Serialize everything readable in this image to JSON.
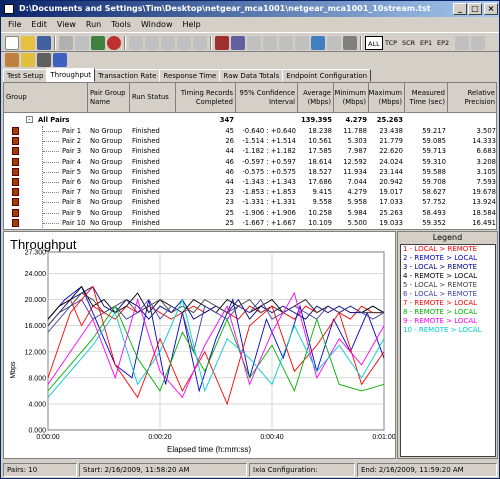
{
  "window": {
    "title": "D:\\Documents and Settings\\Tim\\Desktop\\netgear_mca1001\\netgear_mca1001_10stream.tst"
  },
  "menu": [
    "File",
    "Edit",
    "View",
    "Run",
    "Tools",
    "Window",
    "Help"
  ],
  "toolbar2": {
    "labels": [
      "ALL",
      "TCP",
      "SCR",
      "EP1",
      "EP2"
    ]
  },
  "tabs": [
    "Test Setup",
    "Throughput",
    "Transaction Rate",
    "Response Time",
    "Raw Data Totals",
    "Endpoint Configuration"
  ],
  "table": {
    "headers": [
      "Group",
      "Pair Group\nName",
      "Run Status",
      "Timing Records\nCompleted",
      "95% Confidence\nInterval",
      "Average\n(Mbps)",
      "Minimum\n(Mbps)",
      "Maximum\n(Mbps)",
      "Measured\nTime (sec)",
      "Relative\nPrecision"
    ],
    "all": {
      "label": "All Pairs",
      "records": "347",
      "average": "139.395",
      "minimum": "4.279",
      "maximum": "25.263"
    },
    "rows": [
      {
        "pair": "Pair 1",
        "group": "No Group",
        "status": "Finished",
        "records": "45",
        "ci": "-0.640 : +0.640",
        "avg": "18.238",
        "min": "11.788",
        "max": "23.438",
        "time": "59.217",
        "prec": "3.507"
      },
      {
        "pair": "Pair 2",
        "group": "No Group",
        "status": "Finished",
        "records": "26",
        "ci": "-1.514 : +1.514",
        "avg": "10.561",
        "min": "5.303",
        "max": "21.779",
        "time": "59.085",
        "prec": "14.333"
      },
      {
        "pair": "Pair 3",
        "group": "No Group",
        "status": "Finished",
        "records": "44",
        "ci": "-1.182 : +1.182",
        "avg": "17.585",
        "min": "7.987",
        "max": "22.620",
        "time": "59.713",
        "prec": "6.683"
      },
      {
        "pair": "Pair 4",
        "group": "No Group",
        "status": "Finished",
        "records": "46",
        "ci": "-0.597 : +0.597",
        "avg": "18.614",
        "min": "12.592",
        "max": "24.024",
        "time": "59.310",
        "prec": "3.208"
      },
      {
        "pair": "Pair 5",
        "group": "No Group",
        "status": "Finished",
        "records": "46",
        "ci": "-0.575 : +0.575",
        "avg": "18.527",
        "min": "11.934",
        "max": "23.144",
        "time": "59.588",
        "prec": "3.105"
      },
      {
        "pair": "Pair 6",
        "group": "No Group",
        "status": "Finished",
        "records": "44",
        "ci": "-1.343 : +1.343",
        "avg": "17.686",
        "min": "7.044",
        "max": "20.942",
        "time": "59.708",
        "prec": "7.593"
      },
      {
        "pair": "Pair 7",
        "group": "No Group",
        "status": "Finished",
        "records": "23",
        "ci": "-1.853 : +1.853",
        "avg": "9.415",
        "min": "4.279",
        "max": "19.017",
        "time": "58.627",
        "prec": "19.678"
      },
      {
        "pair": "Pair 8",
        "group": "No Group",
        "status": "Finished",
        "records": "23",
        "ci": "-1.331 : +1.331",
        "avg": "9.558",
        "min": "5.958",
        "max": "17.033",
        "time": "57.752",
        "prec": "13.924"
      },
      {
        "pair": "Pair 9",
        "group": "No Group",
        "status": "Finished",
        "records": "25",
        "ci": "-1.906 : +1.906",
        "avg": "10.258",
        "min": "5.984",
        "max": "25.263",
        "time": "58.493",
        "prec": "18.584"
      },
      {
        "pair": "Pair 10",
        "group": "No Group",
        "status": "Finished",
        "records": "25",
        "ci": "-1.667 : +1.667",
        "avg": "10.109",
        "min": "5.500",
        "max": "19.033",
        "time": "59.352",
        "prec": "16.491"
      }
    ]
  },
  "legend": {
    "title": "Legend",
    "items": [
      {
        "label": "1 - LOCAL > REMOTE",
        "color": "#ff0000"
      },
      {
        "label": "2 - REMOTE > LOCAL",
        "color": "#0000cc"
      },
      {
        "label": "3 - LOCAL > REMOTE",
        "color": "#000080"
      },
      {
        "label": "4 - REMOTE > LOCAL",
        "color": "#000000"
      },
      {
        "label": "5 - LOCAL > REMOTE",
        "color": "#404040"
      },
      {
        "label": "6 - LOCAL > REMOTE",
        "color": "#4040a0"
      },
      {
        "label": "7 - REMOTE > LOCAL",
        "color": "#ff0000"
      },
      {
        "label": "8 - REMOTE > LOCAL",
        "color": "#00b000"
      },
      {
        "label": "9 - REMOTE > LOCAL",
        "color": "#ff00ff"
      },
      {
        "label": "10 - REMOTE > LOCAL",
        "color": "#00cccc"
      }
    ]
  },
  "chart_data": {
    "type": "line",
    "title": "Throughput",
    "xlabel": "Elapsed time (h:mm:ss)",
    "ylabel": "Mbps",
    "ylim": [
      0,
      27.3
    ],
    "xlim": [
      0,
      60
    ],
    "yticks": [
      "0.000",
      "4.000",
      "8.000",
      "12.000",
      "16.000",
      "20.000",
      "24.000",
      "27.300"
    ],
    "xticks": [
      "0:00:00",
      "0:00:20",
      "0:00:40",
      "0:01:00"
    ],
    "series": [
      {
        "name": "1",
        "color": "#ff0000",
        "x": [
          0,
          2,
          4,
          6,
          8,
          10,
          12,
          14,
          16,
          18,
          20,
          22,
          24,
          26,
          28,
          30,
          32,
          34,
          36,
          38,
          40,
          42,
          44,
          46,
          48,
          50,
          52,
          54,
          56,
          58,
          60
        ],
        "values": [
          17,
          19,
          20,
          16,
          19,
          18,
          17,
          19,
          18,
          19,
          18,
          17,
          18,
          19,
          18,
          19,
          18,
          17,
          19,
          18,
          19,
          18,
          17,
          19,
          18,
          19,
          18,
          17,
          19,
          18,
          18
        ]
      },
      {
        "name": "2",
        "color": "#0000cc",
        "x": [
          0,
          3,
          6,
          9,
          12,
          15,
          18,
          21,
          24,
          27,
          30,
          33,
          36,
          39,
          42,
          45,
          48,
          51,
          54,
          57,
          60
        ],
        "values": [
          17,
          20,
          22,
          16,
          10,
          8,
          20,
          7,
          18,
          6,
          14,
          20,
          8,
          17,
          11,
          19,
          9,
          17,
          12,
          18,
          11
        ]
      },
      {
        "name": "3",
        "color": "#000080",
        "x": [
          0,
          2,
          4,
          6,
          8,
          10,
          12,
          14,
          16,
          18,
          20,
          22,
          24,
          26,
          28,
          30,
          32,
          34,
          36,
          38,
          40,
          42,
          44,
          46,
          48,
          50,
          52,
          54,
          56,
          58,
          60
        ],
        "values": [
          16,
          18,
          20,
          21,
          22,
          19,
          18,
          20,
          19,
          17,
          19,
          18,
          20,
          17,
          18,
          19,
          18,
          20,
          17,
          19,
          18,
          19,
          18,
          17,
          19,
          18,
          19,
          18,
          18,
          19,
          18
        ]
      },
      {
        "name": "4",
        "color": "#000000",
        "x": [
          0,
          2,
          4,
          6,
          8,
          10,
          12,
          14,
          16,
          18,
          20,
          22,
          24,
          26,
          28,
          30,
          32,
          34,
          36,
          38,
          40,
          42,
          44,
          46,
          48,
          50,
          52,
          54,
          56,
          58,
          60
        ],
        "values": [
          17,
          19,
          20,
          22,
          19,
          20,
          18,
          19,
          21,
          18,
          20,
          19,
          18,
          20,
          19,
          18,
          20,
          19,
          18,
          19,
          20,
          18,
          19,
          20,
          18,
          19,
          18,
          19,
          18,
          19,
          18
        ]
      },
      {
        "name": "5",
        "color": "#404040",
        "x": [
          0,
          2,
          4,
          6,
          8,
          10,
          12,
          14,
          16,
          18,
          20,
          22,
          24,
          26,
          28,
          30,
          32,
          34,
          36,
          38,
          40,
          42,
          44,
          46,
          48,
          50,
          52,
          54,
          56,
          58,
          60
        ],
        "values": [
          16,
          18,
          19,
          21,
          20,
          18,
          19,
          20,
          18,
          19,
          20,
          18,
          19,
          18,
          20,
          19,
          18,
          19,
          20,
          18,
          19,
          18,
          19,
          20,
          18,
          19,
          18,
          19,
          18,
          18,
          18
        ]
      },
      {
        "name": "6",
        "color": "#4040a0",
        "x": [
          0,
          2,
          4,
          6,
          8,
          10,
          12,
          14,
          16,
          18,
          20,
          22,
          24,
          26,
          28,
          30,
          32,
          34,
          36,
          38,
          40,
          42,
          44,
          46,
          48,
          50,
          52,
          54,
          56,
          58,
          60
        ],
        "values": [
          15,
          17,
          19,
          20,
          17,
          18,
          19,
          17,
          18,
          20,
          17,
          19,
          18,
          12,
          19,
          18,
          17,
          19,
          18,
          20,
          17,
          18,
          19,
          18,
          17,
          19,
          18,
          19,
          18,
          17,
          18
        ]
      },
      {
        "name": "7",
        "color": "#ff0000",
        "x": [
          0,
          4,
          8,
          12,
          16,
          20,
          24,
          28,
          32,
          36,
          40,
          44,
          48,
          52,
          56,
          60
        ],
        "values": [
          8,
          18,
          22,
          10,
          5,
          14,
          6,
          12,
          4,
          16,
          19,
          9,
          13,
          18,
          7,
          12
        ]
      },
      {
        "name": "8",
        "color": "#00b000",
        "x": [
          0,
          4,
          8,
          12,
          16,
          20,
          24,
          28,
          32,
          36,
          40,
          44,
          48,
          52,
          56,
          60
        ],
        "values": [
          6,
          10,
          14,
          19,
          11,
          6,
          15,
          9,
          17,
          8,
          13,
          6,
          17,
          7,
          6,
          7
        ]
      },
      {
        "name": "9",
        "color": "#ff00ff",
        "x": [
          0,
          4,
          8,
          12,
          16,
          20,
          24,
          28,
          32,
          36,
          40,
          44,
          48,
          52,
          56,
          60
        ],
        "values": [
          7,
          12,
          17,
          8,
          20,
          9,
          5,
          13,
          19,
          7,
          15,
          21,
          8,
          14,
          10,
          16
        ]
      },
      {
        "name": "10",
        "color": "#00cccc",
        "x": [
          0,
          4,
          8,
          12,
          16,
          20,
          24,
          28,
          32,
          36,
          40,
          44,
          48,
          52,
          56,
          60
        ],
        "values": [
          5,
          9,
          13,
          18,
          7,
          12,
          20,
          6,
          14,
          11,
          7,
          16,
          9,
          13,
          8,
          14
        ]
      }
    ]
  },
  "status": {
    "pairs": "Pairs: 10",
    "start": "Start: 2/16/2009, 11:58:20 AM",
    "ixia": "Ixia Configuration:",
    "end": "End: 2/16/2009, 11:59:20 AM"
  }
}
